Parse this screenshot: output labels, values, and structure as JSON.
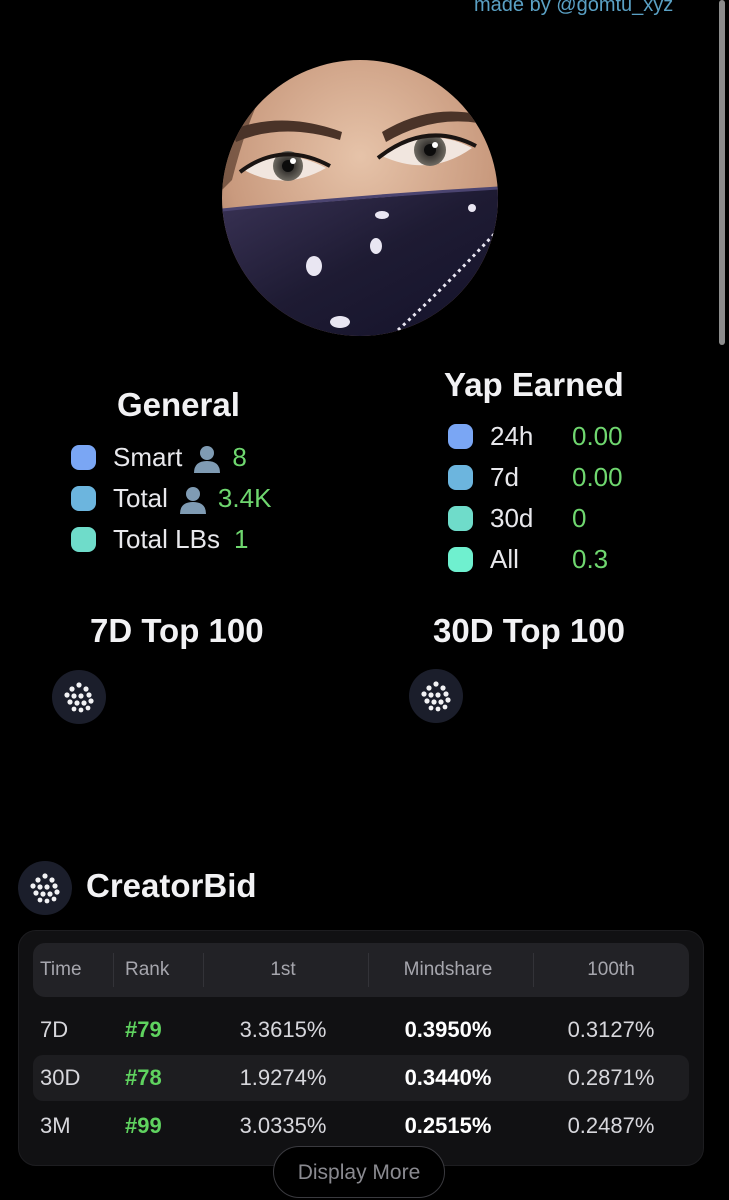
{
  "credit": "made by @gomtu_xyz",
  "general": {
    "title": "General",
    "rows": [
      {
        "label": "Smart",
        "value": "8",
        "color": "#7aa6f4",
        "icon": "person-icon"
      },
      {
        "label": "Total",
        "value": "3.4K",
        "color": "#6cb5de",
        "icon": "person-icon"
      },
      {
        "label": "Total LBs",
        "value": "1",
        "color": "#6fdcca"
      }
    ]
  },
  "yap": {
    "title": "Yap Earned",
    "rows": [
      {
        "label": "24h",
        "value": "0.00",
        "color": "#7aa6f4"
      },
      {
        "label": "7d",
        "value": "0.00",
        "color": "#6cb5de"
      },
      {
        "label": "30d",
        "value": "0",
        "color": "#6fdcca"
      },
      {
        "label": "All",
        "value": "0.3",
        "color": "#6ff0cf"
      }
    ]
  },
  "top7": {
    "title": "7D Top 100",
    "icon": "creatorbid-logo-icon"
  },
  "top30": {
    "title": "30D Top 100",
    "icon": "creatorbid-logo-icon"
  },
  "project": {
    "name": "CreatorBid",
    "icon": "creatorbid-logo-icon"
  },
  "table": {
    "headers": [
      "Time",
      "Rank",
      "1st",
      "Mindshare",
      "100th"
    ],
    "rows": [
      {
        "time": "7D",
        "rank": "#79",
        "first": "3.3615%",
        "mindshare": "0.3950%",
        "hundredth": "0.3127%"
      },
      {
        "time": "30D",
        "rank": "#78",
        "first": "1.9274%",
        "mindshare": "0.3440%",
        "hundredth": "0.2871%"
      },
      {
        "time": "3M",
        "rank": "#99",
        "first": "3.0335%",
        "mindshare": "0.2515%",
        "hundredth": "0.2487%"
      }
    ]
  },
  "display_more": "Display More",
  "accent_green": "#6fd76f"
}
